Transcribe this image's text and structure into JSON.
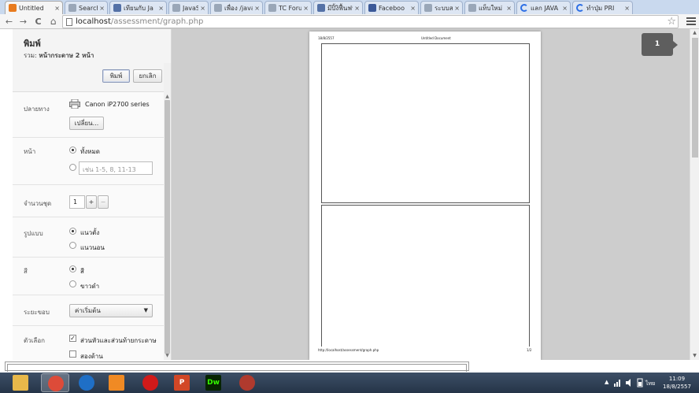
{
  "tabs": [
    {
      "title": "Untitled",
      "favicon": "orange-doc",
      "active": true
    },
    {
      "title": "Search",
      "favicon": "doc"
    },
    {
      "title": "เทียนกับ Ja",
      "favicon": "forum"
    },
    {
      "title": "JavaScrip",
      "favicon": "doc"
    },
    {
      "title": "เพื่อง /java",
      "favicon": "doc"
    },
    {
      "title": "TC Forum",
      "favicon": "doc"
    },
    {
      "title": "มีปิ้งิฟื้นฟนี่",
      "favicon": "forum"
    },
    {
      "title": "Faceboo",
      "favicon": "facebook"
    },
    {
      "title": "ระบบสนับส",
      "favicon": "doc"
    },
    {
      "title": "แท็บใหม่",
      "favicon": "doc"
    },
    {
      "title": "แลก JAVA",
      "favicon": "loading"
    },
    {
      "title": "ทำปุ่ม PRI",
      "favicon": "loading"
    }
  ],
  "tab_close_glyph": "×",
  "toolbar": {
    "back": "←",
    "forward": "→",
    "reload": "C",
    "home": "⌂",
    "url_host": "localhost",
    "url_path": "/assessment/graph.php",
    "star": "☆"
  },
  "print": {
    "title": "พิมพ์",
    "total_label": "รวม:",
    "total_value": "หน้ากระดาษ 2 หน้า",
    "print_button": "พิมพ์",
    "cancel_button": "ยกเลิก",
    "destination": {
      "label": "ปลายทาง",
      "printer": "Canon iP2700 series",
      "change_button": "เปลี่ยน..."
    },
    "pages": {
      "label": "หน้า",
      "all": "ทั้งหมด",
      "custom_placeholder": "เช่น 1-5, 8, 11-13"
    },
    "copies": {
      "label": "จำนวนชุด",
      "value": "1",
      "plus": "+",
      "minus": "−"
    },
    "layout": {
      "label": "รูปแบบ",
      "portrait": "แนวตั้ง",
      "landscape": "แนวนอน"
    },
    "color": {
      "label": "สี",
      "color": "สี",
      "bw": "ขาวดำ"
    },
    "margins": {
      "label": "ระยะขอบ",
      "value": "ค่าเริ่มต้น"
    },
    "options": {
      "label": "ตัวเลือก",
      "headers_footers": "ส่วนหัวและส่วนท้ายกระดาษ",
      "two_sided": "สองด้าน"
    }
  },
  "preview": {
    "header_date": "18/8/2557",
    "header_title": "Untitled Document",
    "footer_url": "http://localhost/assessment/graph.php",
    "footer_page": "1/2",
    "page_badge": "1"
  },
  "taskbar": {
    "apps": [
      {
        "name": "explorer",
        "color": "#e8b84a"
      },
      {
        "name": "chrome",
        "color": "#dd4b39",
        "active": true
      },
      {
        "name": "wmp",
        "color": "#1f6fc6"
      },
      {
        "name": "media-player",
        "color": "#f08a24"
      },
      {
        "name": "opera",
        "color": "#d11a1a"
      },
      {
        "name": "powerpoint",
        "color": "#d24726",
        "label": "P"
      },
      {
        "name": "dreamweaver",
        "color": "#35fa00",
        "label": "Dw"
      },
      {
        "name": "loading",
        "color": "#b03a2e"
      }
    ],
    "lang": "ไทย",
    "time": "11:09",
    "date": "18/8/2557"
  }
}
